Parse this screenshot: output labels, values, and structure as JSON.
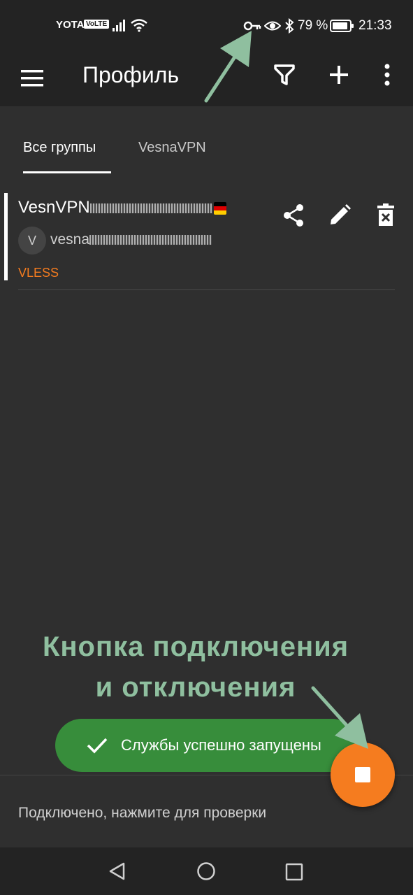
{
  "status_bar": {
    "carrier": "YOTA",
    "volte": "VoLTE",
    "battery_percent": "79 %",
    "time": "21:33",
    "icons": [
      "signal-icon",
      "wifi-icon",
      "vpn-key-icon",
      "eye-icon",
      "bluetooth-icon",
      "battery-icon"
    ]
  },
  "toolbar": {
    "title": "Профиль",
    "icons": [
      "menu-icon",
      "filter-icon",
      "add-icon",
      "more-vert-icon"
    ]
  },
  "tabs": [
    {
      "label": "Все группы",
      "selected": true
    },
    {
      "label": "VesnaVPN",
      "selected": false
    }
  ],
  "profile": {
    "name": "VesnVPN",
    "avatar_letter": "V",
    "subtitle": "vesna",
    "type": "VLESS",
    "actions": [
      "share-icon",
      "edit-icon",
      "delete-icon"
    ]
  },
  "annotation": {
    "line1": "Кнопка подключения",
    "line2": "и отключения"
  },
  "snackbar": {
    "text": "Службы успешно запущены"
  },
  "bottom_status": {
    "text": "Подключено, нажмите для проверки"
  },
  "colors": {
    "background": "#2f2f2f",
    "bars": "#232323",
    "accent": "#f57c1f",
    "snackbar": "#378d3b",
    "annotation": "#8fbf9f"
  }
}
